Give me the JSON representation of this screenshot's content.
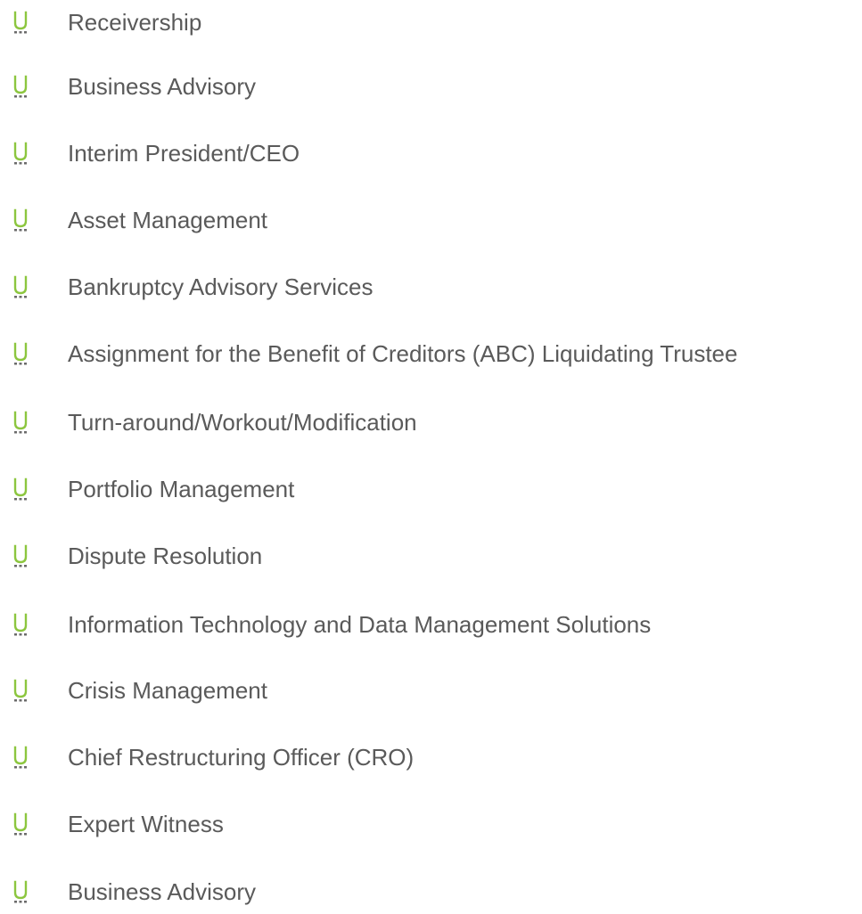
{
  "colors": {
    "bullet_green": "#8cc63f",
    "bullet_dots": "#6b6b6b",
    "text": "#5a5a5a"
  },
  "bullet_icon": "u-bullet-icon",
  "services": [
    "Receivership",
    "Business Advisory",
    "Interim President/CEO",
    "Asset Management",
    "Bankruptcy Advisory Services",
    "Assignment for the Benefit of Creditors (ABC) Liquidating Trustee",
    "Turn-around/Workout/Modification",
    "Portfolio Management",
    "Dispute Resolution",
    "Information Technology and Data Management Solutions",
    "Crisis Management",
    "Chief Restructuring Officer (CRO)",
    "Expert Witness",
    "Business Advisory"
  ]
}
